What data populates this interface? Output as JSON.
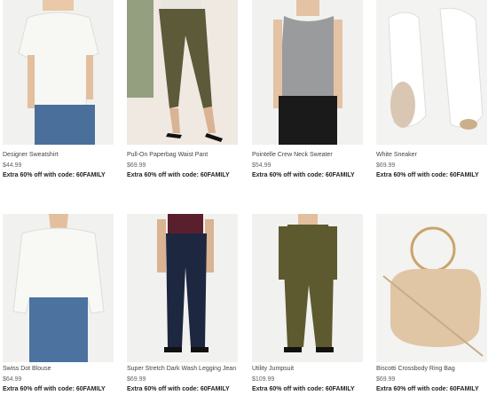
{
  "products": [
    {
      "name": "Designer Sweatshirt",
      "price": "$44.99",
      "promo": "Extra 60% off with code: 60FAMILY"
    },
    {
      "name": "Pull-On Paperbag Waist Pant",
      "price": "$69.99",
      "promo": "Extra 60% off with code: 60FAMILY"
    },
    {
      "name": "Pointelle Crew Neck Sweater",
      "price": "$54.99",
      "promo": "Extra 60% off with code: 60FAMILY"
    },
    {
      "name": "White Sneaker",
      "price": "$69.99",
      "promo": "Extra 60% off with code: 60FAMILY"
    },
    {
      "name": "Swiss Dot Blouse",
      "price": "$64.99",
      "promo": "Extra 60% off with code: 60FAMILY"
    },
    {
      "name": "Super Stretch Dark Wash Legging Jean",
      "price": "$69.99",
      "promo": "Extra 60% off with code: 60FAMILY"
    },
    {
      "name": "Utility Jumpsuit",
      "price": "$109.99",
      "promo": "Extra 60% off with code: 60FAMILY"
    },
    {
      "name": "Biscotti Crossbody Ring Bag",
      "price": "$69.99",
      "promo": "Extra 60% off with code: 60FAMILY"
    }
  ]
}
